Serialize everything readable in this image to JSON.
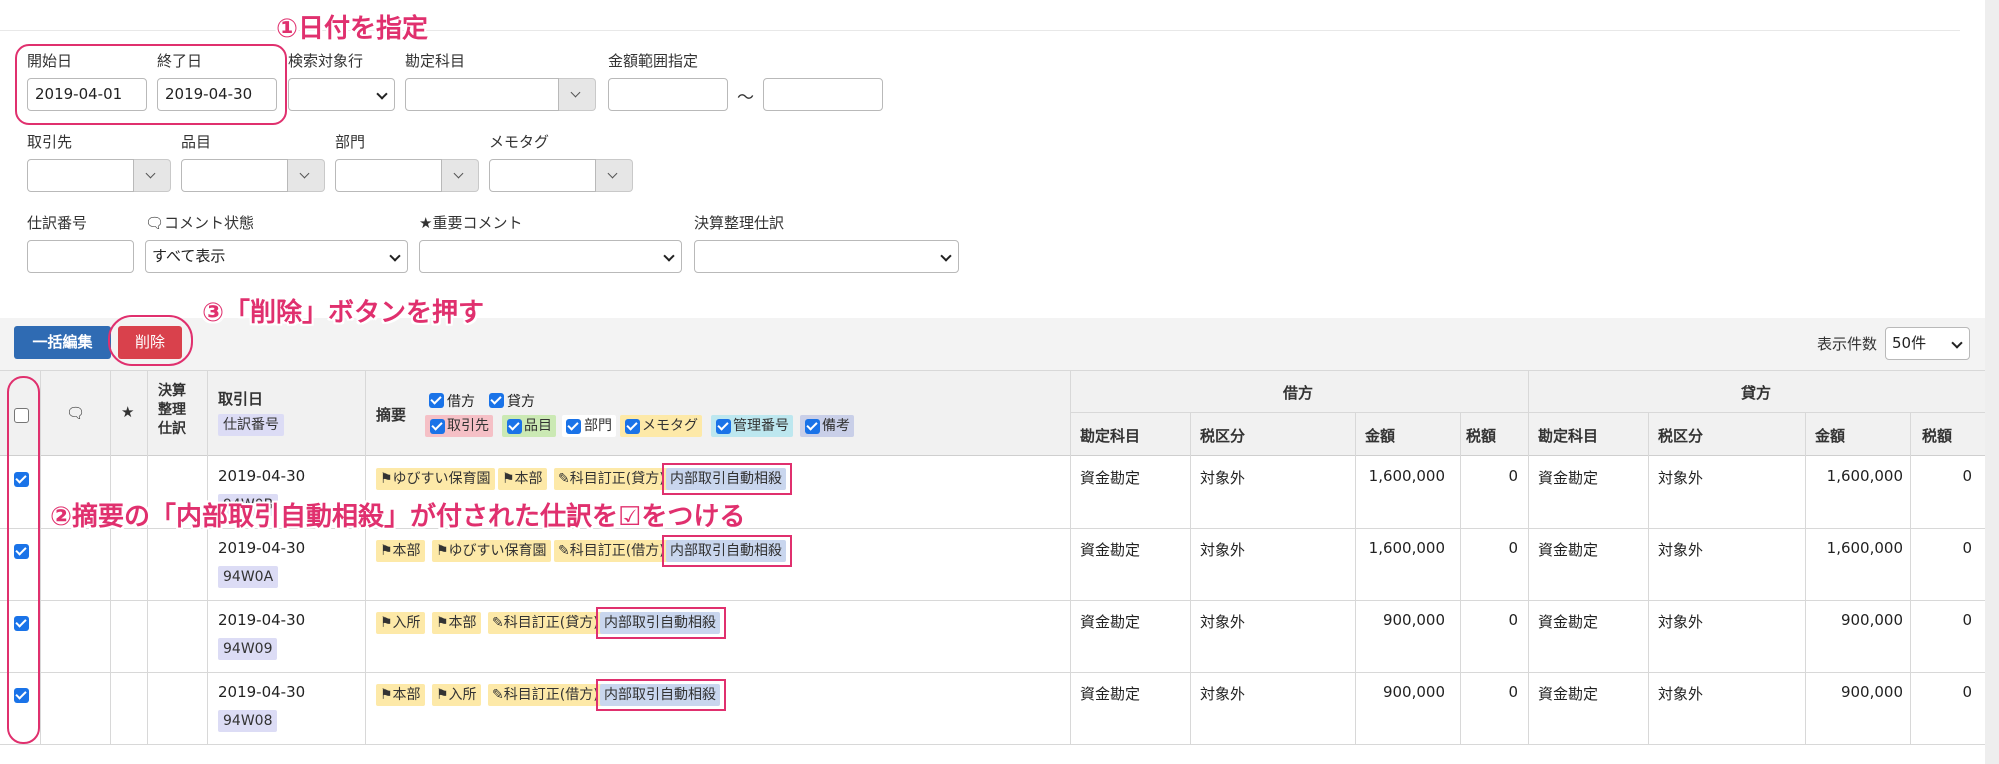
{
  "annotations": {
    "step1": "①日付を指定",
    "step2": "②摘要の「内部取引自動相殺」が付された仕訳を☑をつける",
    "step3": "③「削除」ボタンを押す"
  },
  "filters": {
    "start_date": {
      "label": "開始日",
      "value": "2019-04-01"
    },
    "end_date": {
      "label": "終了日",
      "value": "2019-04-30"
    },
    "search_row": {
      "label": "検索対象行",
      "value": ""
    },
    "account": {
      "label": "勘定科目",
      "value": ""
    },
    "amount_range": {
      "label": "金額範囲指定",
      "separator": "〜"
    },
    "partner": {
      "label": "取引先"
    },
    "item": {
      "label": "品目"
    },
    "department": {
      "label": "部門"
    },
    "memo_tag": {
      "label": "メモタグ"
    },
    "slip_no": {
      "label": "仕訳番号"
    },
    "comment_state": {
      "label": "コメント状態",
      "value": "すべて表示"
    },
    "important_comment": {
      "label": "重要コメント"
    },
    "closing_entry": {
      "label": "決算整理仕訳"
    }
  },
  "toolbar": {
    "bulk_edit": "一括編集",
    "delete": "削除",
    "per_page_label": "表示件数",
    "per_page_value": "50件"
  },
  "table": {
    "headers": {
      "closing": [
        "決算",
        "整理",
        "仕訳"
      ],
      "date": "取引日",
      "slip_no": "仕訳番号",
      "summary": "摘要",
      "debit": "借方",
      "credit": "貸方",
      "account": "勘定科目",
      "tax_class": "税区分",
      "amount": "金額",
      "tax": "税額"
    },
    "summary_filters": {
      "debit": "借方",
      "credit": "貸方",
      "partner": "取引先",
      "item": "品目",
      "department": "部門",
      "memo_tag": "メモタグ",
      "control_no": "管理番号",
      "note": "備考"
    },
    "rows": [
      {
        "date": "2019-04-30",
        "slip": "94W0B",
        "tags": [
          "⚑ゆびすい保育園",
          "⚑本部",
          "✎科目訂正(貸方)"
        ],
        "auto_tag": "内部取引自動相殺",
        "debit_account": "資金勘定",
        "debit_tax": "対象外",
        "debit_amount": "1,600,000",
        "debit_tax_amount": "0",
        "credit_account": "資金勘定",
        "credit_tax": "対象外",
        "credit_amount": "1,600,000",
        "credit_tax_amount": "0"
      },
      {
        "date": "2019-04-30",
        "slip": "94W0A",
        "tags": [
          "⚑本部",
          "⚑ゆびすい保育園",
          "✎科目訂正(借方)"
        ],
        "auto_tag": "内部取引自動相殺",
        "debit_account": "資金勘定",
        "debit_tax": "対象外",
        "debit_amount": "1,600,000",
        "debit_tax_amount": "0",
        "credit_account": "資金勘定",
        "credit_tax": "対象外",
        "credit_amount": "1,600,000",
        "credit_tax_amount": "0"
      },
      {
        "date": "2019-04-30",
        "slip": "94W09",
        "tags": [
          "⚑入所",
          "⚑本部",
          "✎科目訂正(貸方)"
        ],
        "auto_tag": "内部取引自動相殺",
        "debit_account": "資金勘定",
        "debit_tax": "対象外",
        "debit_amount": "900,000",
        "debit_tax_amount": "0",
        "credit_account": "資金勘定",
        "credit_tax": "対象外",
        "credit_amount": "900,000",
        "credit_tax_amount": "0"
      },
      {
        "date": "2019-04-30",
        "slip": "94W08",
        "tags": [
          "⚑本部",
          "⚑入所",
          "✎科目訂正(借方)"
        ],
        "auto_tag": "内部取引自動相殺",
        "debit_account": "資金勘定",
        "debit_tax": "対象外",
        "debit_amount": "900,000",
        "debit_tax_amount": "0",
        "credit_account": "資金勘定",
        "credit_tax": "対象外",
        "credit_amount": "900,000",
        "credit_tax_amount": "0"
      }
    ]
  },
  "icons": {
    "comment": "comment-icon",
    "star": "star-icon",
    "caret": "chevron-down-icon",
    "flag": "flag-icon",
    "tag": "tag-icon"
  },
  "colors": {
    "primary": "#2f6bb3",
    "danger": "#d9414c",
    "annotation": "#e0306e",
    "checkbox": "#1a73e8"
  }
}
